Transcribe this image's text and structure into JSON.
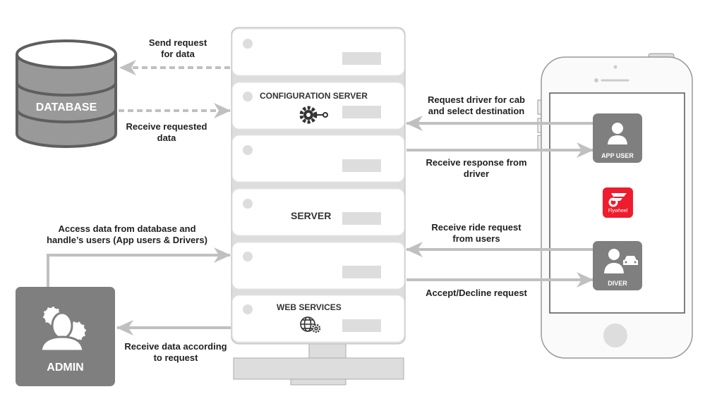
{
  "database": {
    "label": "DATABASE"
  },
  "server": {
    "config_label": "CONFIGURATION SERVER",
    "server_label": "SERVER",
    "web_services_label": "WEB SERVICES"
  },
  "arrows": {
    "send_request": "Send request\nfor data",
    "receive_requested": "Receive requested\ndata",
    "request_driver": "Request driver for cab\nand select destination",
    "receive_response": "Receive response from\ndriver",
    "receive_ride_request": "Receive ride request\nfrom users",
    "accept_decline": "Accept/Decline request",
    "admin_access": "Access data from database and\nhandle’s users (App users & Drivers)",
    "receive_data": "Receive data according\nto request"
  },
  "phone": {
    "app_user_label": "APP USER",
    "driver_label": "DIVER",
    "logo_text": "Flywheel"
  },
  "admin": {
    "label": "ADMIN"
  },
  "colors": {
    "arrow": "#c0c0c0",
    "tile": "#7f7f7f",
    "brand": "#ee1c2d",
    "db": "#999999"
  }
}
